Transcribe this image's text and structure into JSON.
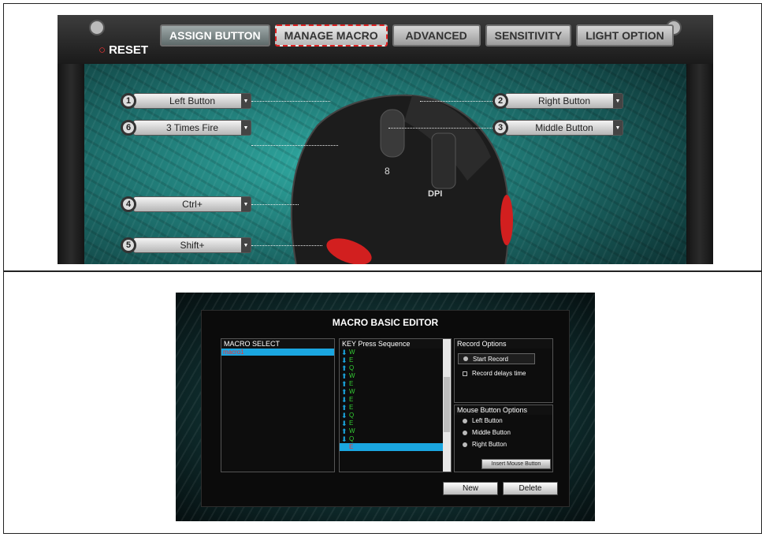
{
  "top": {
    "reset_label": "RESET",
    "tabs": [
      "ASSIGN BUTTON",
      "MANAGE MACRO",
      "ADVANCED",
      "SENSITIVITY",
      "LIGHT OPTION"
    ],
    "buttons": [
      {
        "num": "1",
        "label": "Left Button"
      },
      {
        "num": "6",
        "label": "3 Times Fire"
      },
      {
        "num": "4",
        "label": "Ctrl+"
      },
      {
        "num": "5",
        "label": "Shift+"
      },
      {
        "num": "2",
        "label": "Right Button"
      },
      {
        "num": "3",
        "label": "Middle Button"
      }
    ],
    "mouse_text": "DPI",
    "colors": {
      "accent_red": "#e33",
      "teal": "#2fa9a1"
    }
  },
  "editor": {
    "title": "MACRO BASIC EDITOR",
    "macro_select_header": "MACRO SELECT",
    "macro_items": [
      "macro1"
    ],
    "sequence_header": "KEY Press Sequence",
    "sequence": [
      {
        "dir": "down",
        "key": "W"
      },
      {
        "dir": "down",
        "key": "E"
      },
      {
        "dir": "up",
        "key": "Q"
      },
      {
        "dir": "up",
        "key": "W"
      },
      {
        "dir": "up",
        "key": "E"
      },
      {
        "dir": "up",
        "key": "W"
      },
      {
        "dir": "down",
        "key": "E"
      },
      {
        "dir": "up",
        "key": "E"
      },
      {
        "dir": "down",
        "key": "Q"
      },
      {
        "dir": "down",
        "key": "E"
      },
      {
        "dir": "up",
        "key": "W"
      },
      {
        "dir": "down",
        "key": "Q"
      },
      {
        "dir": "up",
        "key": "E"
      }
    ],
    "record_header": "Record Options",
    "start_record": "Start Record",
    "record_delays": "Record delays time",
    "mouse_header": "Mouse Button Options",
    "mouse_options": [
      "Left Button",
      "Middle Button",
      "Right Button"
    ],
    "insert_mouse": "Insert Mouse Button",
    "new_label": "New",
    "delete_label": "Delete"
  }
}
